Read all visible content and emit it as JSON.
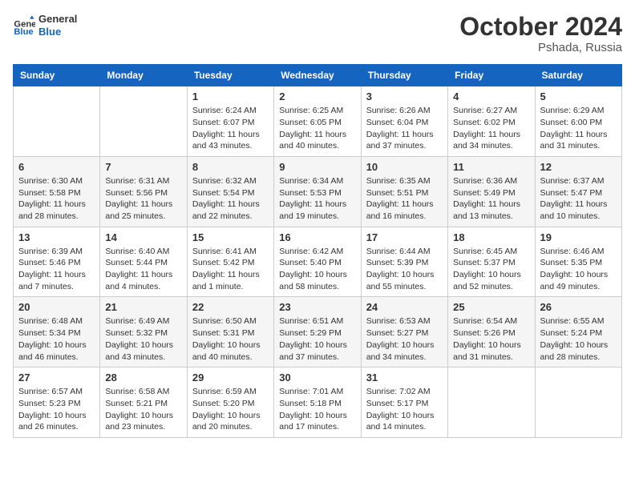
{
  "header": {
    "logo_line1": "General",
    "logo_line2": "Blue",
    "month": "October 2024",
    "location": "Pshada, Russia"
  },
  "weekdays": [
    "Sunday",
    "Monday",
    "Tuesday",
    "Wednesday",
    "Thursday",
    "Friday",
    "Saturday"
  ],
  "weeks": [
    [
      {
        "day": "",
        "sunrise": "",
        "sunset": "",
        "daylight": ""
      },
      {
        "day": "",
        "sunrise": "",
        "sunset": "",
        "daylight": ""
      },
      {
        "day": "1",
        "sunrise": "Sunrise: 6:24 AM",
        "sunset": "Sunset: 6:07 PM",
        "daylight": "Daylight: 11 hours and 43 minutes."
      },
      {
        "day": "2",
        "sunrise": "Sunrise: 6:25 AM",
        "sunset": "Sunset: 6:05 PM",
        "daylight": "Daylight: 11 hours and 40 minutes."
      },
      {
        "day": "3",
        "sunrise": "Sunrise: 6:26 AM",
        "sunset": "Sunset: 6:04 PM",
        "daylight": "Daylight: 11 hours and 37 minutes."
      },
      {
        "day": "4",
        "sunrise": "Sunrise: 6:27 AM",
        "sunset": "Sunset: 6:02 PM",
        "daylight": "Daylight: 11 hours and 34 minutes."
      },
      {
        "day": "5",
        "sunrise": "Sunrise: 6:29 AM",
        "sunset": "Sunset: 6:00 PM",
        "daylight": "Daylight: 11 hours and 31 minutes."
      }
    ],
    [
      {
        "day": "6",
        "sunrise": "Sunrise: 6:30 AM",
        "sunset": "Sunset: 5:58 PM",
        "daylight": "Daylight: 11 hours and 28 minutes."
      },
      {
        "day": "7",
        "sunrise": "Sunrise: 6:31 AM",
        "sunset": "Sunset: 5:56 PM",
        "daylight": "Daylight: 11 hours and 25 minutes."
      },
      {
        "day": "8",
        "sunrise": "Sunrise: 6:32 AM",
        "sunset": "Sunset: 5:54 PM",
        "daylight": "Daylight: 11 hours and 22 minutes."
      },
      {
        "day": "9",
        "sunrise": "Sunrise: 6:34 AM",
        "sunset": "Sunset: 5:53 PM",
        "daylight": "Daylight: 11 hours and 19 minutes."
      },
      {
        "day": "10",
        "sunrise": "Sunrise: 6:35 AM",
        "sunset": "Sunset: 5:51 PM",
        "daylight": "Daylight: 11 hours and 16 minutes."
      },
      {
        "day": "11",
        "sunrise": "Sunrise: 6:36 AM",
        "sunset": "Sunset: 5:49 PM",
        "daylight": "Daylight: 11 hours and 13 minutes."
      },
      {
        "day": "12",
        "sunrise": "Sunrise: 6:37 AM",
        "sunset": "Sunset: 5:47 PM",
        "daylight": "Daylight: 11 hours and 10 minutes."
      }
    ],
    [
      {
        "day": "13",
        "sunrise": "Sunrise: 6:39 AM",
        "sunset": "Sunset: 5:46 PM",
        "daylight": "Daylight: 11 hours and 7 minutes."
      },
      {
        "day": "14",
        "sunrise": "Sunrise: 6:40 AM",
        "sunset": "Sunset: 5:44 PM",
        "daylight": "Daylight: 11 hours and 4 minutes."
      },
      {
        "day": "15",
        "sunrise": "Sunrise: 6:41 AM",
        "sunset": "Sunset: 5:42 PM",
        "daylight": "Daylight: 11 hours and 1 minute."
      },
      {
        "day": "16",
        "sunrise": "Sunrise: 6:42 AM",
        "sunset": "Sunset: 5:40 PM",
        "daylight": "Daylight: 10 hours and 58 minutes."
      },
      {
        "day": "17",
        "sunrise": "Sunrise: 6:44 AM",
        "sunset": "Sunset: 5:39 PM",
        "daylight": "Daylight: 10 hours and 55 minutes."
      },
      {
        "day": "18",
        "sunrise": "Sunrise: 6:45 AM",
        "sunset": "Sunset: 5:37 PM",
        "daylight": "Daylight: 10 hours and 52 minutes."
      },
      {
        "day": "19",
        "sunrise": "Sunrise: 6:46 AM",
        "sunset": "Sunset: 5:35 PM",
        "daylight": "Daylight: 10 hours and 49 minutes."
      }
    ],
    [
      {
        "day": "20",
        "sunrise": "Sunrise: 6:48 AM",
        "sunset": "Sunset: 5:34 PM",
        "daylight": "Daylight: 10 hours and 46 minutes."
      },
      {
        "day": "21",
        "sunrise": "Sunrise: 6:49 AM",
        "sunset": "Sunset: 5:32 PM",
        "daylight": "Daylight: 10 hours and 43 minutes."
      },
      {
        "day": "22",
        "sunrise": "Sunrise: 6:50 AM",
        "sunset": "Sunset: 5:31 PM",
        "daylight": "Daylight: 10 hours and 40 minutes."
      },
      {
        "day": "23",
        "sunrise": "Sunrise: 6:51 AM",
        "sunset": "Sunset: 5:29 PM",
        "daylight": "Daylight: 10 hours and 37 minutes."
      },
      {
        "day": "24",
        "sunrise": "Sunrise: 6:53 AM",
        "sunset": "Sunset: 5:27 PM",
        "daylight": "Daylight: 10 hours and 34 minutes."
      },
      {
        "day": "25",
        "sunrise": "Sunrise: 6:54 AM",
        "sunset": "Sunset: 5:26 PM",
        "daylight": "Daylight: 10 hours and 31 minutes."
      },
      {
        "day": "26",
        "sunrise": "Sunrise: 6:55 AM",
        "sunset": "Sunset: 5:24 PM",
        "daylight": "Daylight: 10 hours and 28 minutes."
      }
    ],
    [
      {
        "day": "27",
        "sunrise": "Sunrise: 6:57 AM",
        "sunset": "Sunset: 5:23 PM",
        "daylight": "Daylight: 10 hours and 26 minutes."
      },
      {
        "day": "28",
        "sunrise": "Sunrise: 6:58 AM",
        "sunset": "Sunset: 5:21 PM",
        "daylight": "Daylight: 10 hours and 23 minutes."
      },
      {
        "day": "29",
        "sunrise": "Sunrise: 6:59 AM",
        "sunset": "Sunset: 5:20 PM",
        "daylight": "Daylight: 10 hours and 20 minutes."
      },
      {
        "day": "30",
        "sunrise": "Sunrise: 7:01 AM",
        "sunset": "Sunset: 5:18 PM",
        "daylight": "Daylight: 10 hours and 17 minutes."
      },
      {
        "day": "31",
        "sunrise": "Sunrise: 7:02 AM",
        "sunset": "Sunset: 5:17 PM",
        "daylight": "Daylight: 10 hours and 14 minutes."
      },
      {
        "day": "",
        "sunrise": "",
        "sunset": "",
        "daylight": ""
      },
      {
        "day": "",
        "sunrise": "",
        "sunset": "",
        "daylight": ""
      }
    ]
  ]
}
